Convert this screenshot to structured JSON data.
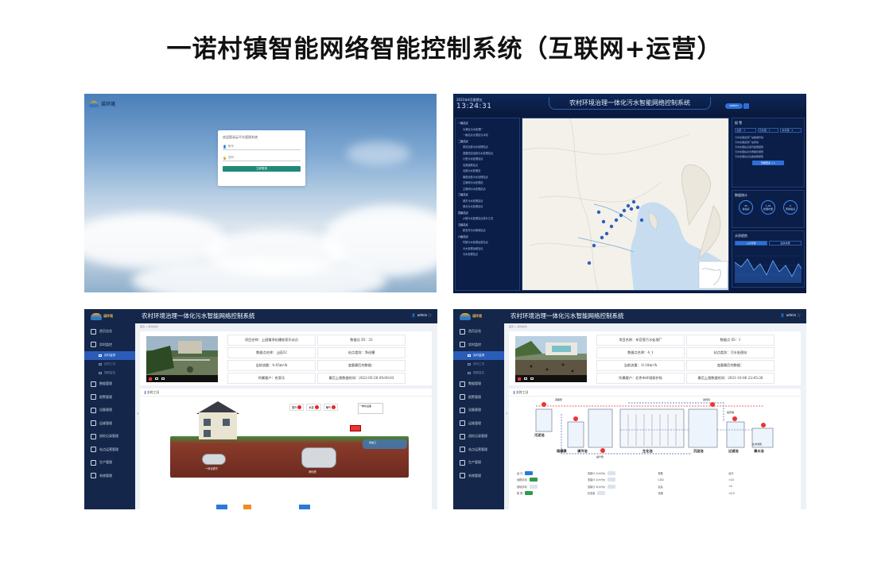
{
  "page_title": "一诺村镇智能网络智能控制系统（互联网+运营）",
  "login": {
    "logo_text": "诺环境",
    "welcome": "欢迎登录云平台管理系统",
    "username_placeholder": "账号",
    "password_placeholder": "密码",
    "submit_label": "立即登录"
  },
  "dashboard": {
    "date": "2021年4月星期五",
    "time": "13:24:31",
    "title": "农村环境治理一体化污水智能网络控制系统",
    "user": "admin",
    "tree": [
      {
        "label": "一级站点",
        "group": true
      },
      {
        "label": "大港区污水处理厂",
        "group": false
      },
      {
        "label": "一级站点大港区污水站",
        "group": false
      },
      {
        "label": "二级站点",
        "group": true
      },
      {
        "label": "单站北部污水处理站点",
        "group": false
      },
      {
        "label": "道路西边运营污水处理站点",
        "group": false
      },
      {
        "label": "小型污水处理站点",
        "group": false
      },
      {
        "label": "北部建筑站点",
        "group": false
      },
      {
        "label": "北部污水处理站",
        "group": false
      },
      {
        "label": "南部运营污水处理站点",
        "group": false
      },
      {
        "label": "主管网污水处理站",
        "group": false
      },
      {
        "label": "主管网污水处理站点",
        "group": false
      },
      {
        "label": "三级站点",
        "group": true
      },
      {
        "label": "城东污水处理站点",
        "group": false
      },
      {
        "label": "城北污水处理站点",
        "group": false
      },
      {
        "label": "四级站点",
        "group": true
      },
      {
        "label": "乡镇污水处理站点统计汇总",
        "group": false
      },
      {
        "label": "五级站点",
        "group": true
      },
      {
        "label": "新农村污水管网站点",
        "group": false
      },
      {
        "label": "六级站点",
        "group": true
      },
      {
        "label": "村镇污水处理运营站点",
        "group": false
      },
      {
        "label": "污水处理运维站点",
        "group": false
      },
      {
        "label": "污水处理站点",
        "group": false
      }
    ],
    "alarm": {
      "title": "报 警",
      "chips": [
        "全部：3",
        "已处理：1",
        "未处理：2"
      ],
      "lines": [
        "污水处理运营厂站数据异常",
        "污水处理运营厂站离线",
        "污水处理站点通讯故障报警",
        "污水处理站点水质超标报警",
        "污水处理站点设备故障报警"
      ],
      "more_label": "查看更多 >>"
    },
    "stats": {
      "title": "数据统计",
      "rings": [
        {
          "value": "20",
          "label": "总站点"
        },
        {
          "value": "1.26",
          "label": "处理水量"
        },
        {
          "value": "0",
          "label": "离线站点"
        }
      ]
    },
    "trend": {
      "title": "水质趋势",
      "tabs": [
        "入水流量",
        "出水水质"
      ]
    }
  },
  "app": {
    "logo_text": "诺环境",
    "title": "农村环境治理一体化污水智能网络控制系统",
    "user": "admin",
    "crumb": "首页 > 实时监测",
    "menu": [
      {
        "label": "首页总览",
        "sub": false,
        "on": false
      },
      {
        "label": "实时监控",
        "sub": false,
        "on": false
      },
      {
        "label": "实时监测",
        "sub": true,
        "on": true
      },
      {
        "label": "实时工况",
        "sub": true,
        "on": false
      },
      {
        "label": "视频监控",
        "sub": true,
        "on": false
      },
      {
        "label": "数据管理",
        "sub": false,
        "on": false
      },
      {
        "label": "报警管理",
        "sub": false,
        "on": false
      },
      {
        "label": "设备管理",
        "sub": false,
        "on": false
      },
      {
        "label": "运维管理",
        "sub": false,
        "on": false
      },
      {
        "label": "巡检记录管理",
        "sub": false,
        "on": false
      },
      {
        "label": "站点运营管理",
        "sub": false,
        "on": false
      },
      {
        "label": "生产管理",
        "sub": false,
        "on": false
      },
      {
        "label": "系统管理",
        "sub": false,
        "on": false
      }
    ],
    "section_title": "实时工况"
  },
  "site1": {
    "cells": [
      "项目名称：上园镇净化槽农家乐站点",
      "数据点 ID：32",
      "数据点名称：上园32",
      "站点类别：净化槽",
      "当前流量：0.45m³/h",
      "变量最后的数据：",
      "所属客户：农家乐",
      "最后上报数据时间：2022-05-28 09:00:03"
    ],
    "legend": [
      "提升",
      "水泵",
      "曝气"
    ],
    "labels": {
      "wall_tag": "一体化设备",
      "tank1": "一体化调节",
      "tank2": "净化槽",
      "river": "排放口"
    }
  },
  "site2": {
    "cells": [
      "项目名称：东官营污水处理厂",
      "数据点 ID：1",
      "数据点名称：4_1",
      "站点类别：污水处理站",
      "当前流量：-0.18m³/h",
      "变量最后的数据：",
      "所属客户：北京市环境保护局",
      "最后上报数据时间：2021-10-06 22:45:36"
    ],
    "process_labels": [
      "污泥池",
      "格栅渠",
      "调节池",
      "生化池",
      "沉淀池",
      "过滤池",
      "清水池"
    ],
    "minor_labels": [
      "旁路泵",
      "提升泵",
      "鼓风机",
      "加药罐",
      "反冲洗泵"
    ],
    "table": [
      [
        "运 行",
        "流量计 1(m³/h)",
        "参数",
        "运行"
      ],
      [
        "远程手动",
        "流量计 2(m³/h)",
        "COD",
        "<10"
      ],
      [
        "就地手动",
        "流量计 3(m³/h)",
        "氨氮",
        "<5"
      ],
      [
        "故 障",
        "总流量",
        "总磷",
        "<0.5"
      ]
    ]
  }
}
